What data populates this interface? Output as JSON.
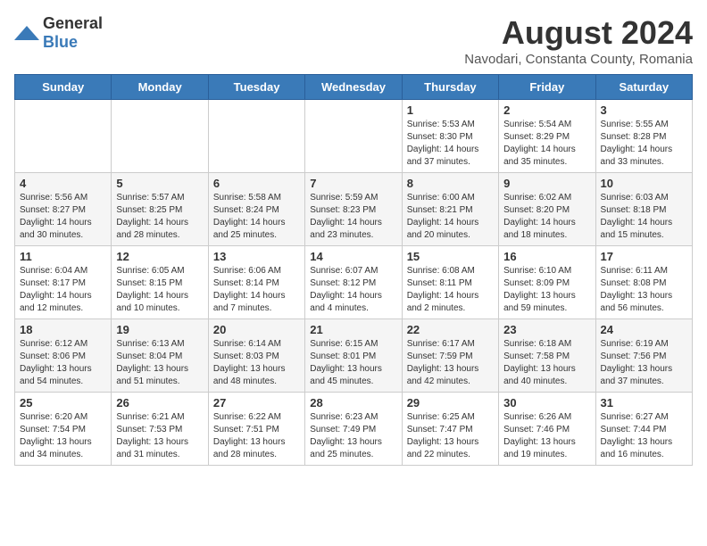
{
  "logo": {
    "general": "General",
    "blue": "Blue"
  },
  "title": "August 2024",
  "subtitle": "Navodari, Constanta County, Romania",
  "days_of_week": [
    "Sunday",
    "Monday",
    "Tuesday",
    "Wednesday",
    "Thursday",
    "Friday",
    "Saturday"
  ],
  "weeks": [
    [
      {
        "day": "",
        "info": ""
      },
      {
        "day": "",
        "info": ""
      },
      {
        "day": "",
        "info": ""
      },
      {
        "day": "",
        "info": ""
      },
      {
        "day": "1",
        "info": "Sunrise: 5:53 AM\nSunset: 8:30 PM\nDaylight: 14 hours\nand 37 minutes."
      },
      {
        "day": "2",
        "info": "Sunrise: 5:54 AM\nSunset: 8:29 PM\nDaylight: 14 hours\nand 35 minutes."
      },
      {
        "day": "3",
        "info": "Sunrise: 5:55 AM\nSunset: 8:28 PM\nDaylight: 14 hours\nand 33 minutes."
      }
    ],
    [
      {
        "day": "4",
        "info": "Sunrise: 5:56 AM\nSunset: 8:27 PM\nDaylight: 14 hours\nand 30 minutes."
      },
      {
        "day": "5",
        "info": "Sunrise: 5:57 AM\nSunset: 8:25 PM\nDaylight: 14 hours\nand 28 minutes."
      },
      {
        "day": "6",
        "info": "Sunrise: 5:58 AM\nSunset: 8:24 PM\nDaylight: 14 hours\nand 25 minutes."
      },
      {
        "day": "7",
        "info": "Sunrise: 5:59 AM\nSunset: 8:23 PM\nDaylight: 14 hours\nand 23 minutes."
      },
      {
        "day": "8",
        "info": "Sunrise: 6:00 AM\nSunset: 8:21 PM\nDaylight: 14 hours\nand 20 minutes."
      },
      {
        "day": "9",
        "info": "Sunrise: 6:02 AM\nSunset: 8:20 PM\nDaylight: 14 hours\nand 18 minutes."
      },
      {
        "day": "10",
        "info": "Sunrise: 6:03 AM\nSunset: 8:18 PM\nDaylight: 14 hours\nand 15 minutes."
      }
    ],
    [
      {
        "day": "11",
        "info": "Sunrise: 6:04 AM\nSunset: 8:17 PM\nDaylight: 14 hours\nand 12 minutes."
      },
      {
        "day": "12",
        "info": "Sunrise: 6:05 AM\nSunset: 8:15 PM\nDaylight: 14 hours\nand 10 minutes."
      },
      {
        "day": "13",
        "info": "Sunrise: 6:06 AM\nSunset: 8:14 PM\nDaylight: 14 hours\nand 7 minutes."
      },
      {
        "day": "14",
        "info": "Sunrise: 6:07 AM\nSunset: 8:12 PM\nDaylight: 14 hours\nand 4 minutes."
      },
      {
        "day": "15",
        "info": "Sunrise: 6:08 AM\nSunset: 8:11 PM\nDaylight: 14 hours\nand 2 minutes."
      },
      {
        "day": "16",
        "info": "Sunrise: 6:10 AM\nSunset: 8:09 PM\nDaylight: 13 hours\nand 59 minutes."
      },
      {
        "day": "17",
        "info": "Sunrise: 6:11 AM\nSunset: 8:08 PM\nDaylight: 13 hours\nand 56 minutes."
      }
    ],
    [
      {
        "day": "18",
        "info": "Sunrise: 6:12 AM\nSunset: 8:06 PM\nDaylight: 13 hours\nand 54 minutes."
      },
      {
        "day": "19",
        "info": "Sunrise: 6:13 AM\nSunset: 8:04 PM\nDaylight: 13 hours\nand 51 minutes."
      },
      {
        "day": "20",
        "info": "Sunrise: 6:14 AM\nSunset: 8:03 PM\nDaylight: 13 hours\nand 48 minutes."
      },
      {
        "day": "21",
        "info": "Sunrise: 6:15 AM\nSunset: 8:01 PM\nDaylight: 13 hours\nand 45 minutes."
      },
      {
        "day": "22",
        "info": "Sunrise: 6:17 AM\nSunset: 7:59 PM\nDaylight: 13 hours\nand 42 minutes."
      },
      {
        "day": "23",
        "info": "Sunrise: 6:18 AM\nSunset: 7:58 PM\nDaylight: 13 hours\nand 40 minutes."
      },
      {
        "day": "24",
        "info": "Sunrise: 6:19 AM\nSunset: 7:56 PM\nDaylight: 13 hours\nand 37 minutes."
      }
    ],
    [
      {
        "day": "25",
        "info": "Sunrise: 6:20 AM\nSunset: 7:54 PM\nDaylight: 13 hours\nand 34 minutes."
      },
      {
        "day": "26",
        "info": "Sunrise: 6:21 AM\nSunset: 7:53 PM\nDaylight: 13 hours\nand 31 minutes."
      },
      {
        "day": "27",
        "info": "Sunrise: 6:22 AM\nSunset: 7:51 PM\nDaylight: 13 hours\nand 28 minutes."
      },
      {
        "day": "28",
        "info": "Sunrise: 6:23 AM\nSunset: 7:49 PM\nDaylight: 13 hours\nand 25 minutes."
      },
      {
        "day": "29",
        "info": "Sunrise: 6:25 AM\nSunset: 7:47 PM\nDaylight: 13 hours\nand 22 minutes."
      },
      {
        "day": "30",
        "info": "Sunrise: 6:26 AM\nSunset: 7:46 PM\nDaylight: 13 hours\nand 19 minutes."
      },
      {
        "day": "31",
        "info": "Sunrise: 6:27 AM\nSunset: 7:44 PM\nDaylight: 13 hours\nand 16 minutes."
      }
    ]
  ]
}
